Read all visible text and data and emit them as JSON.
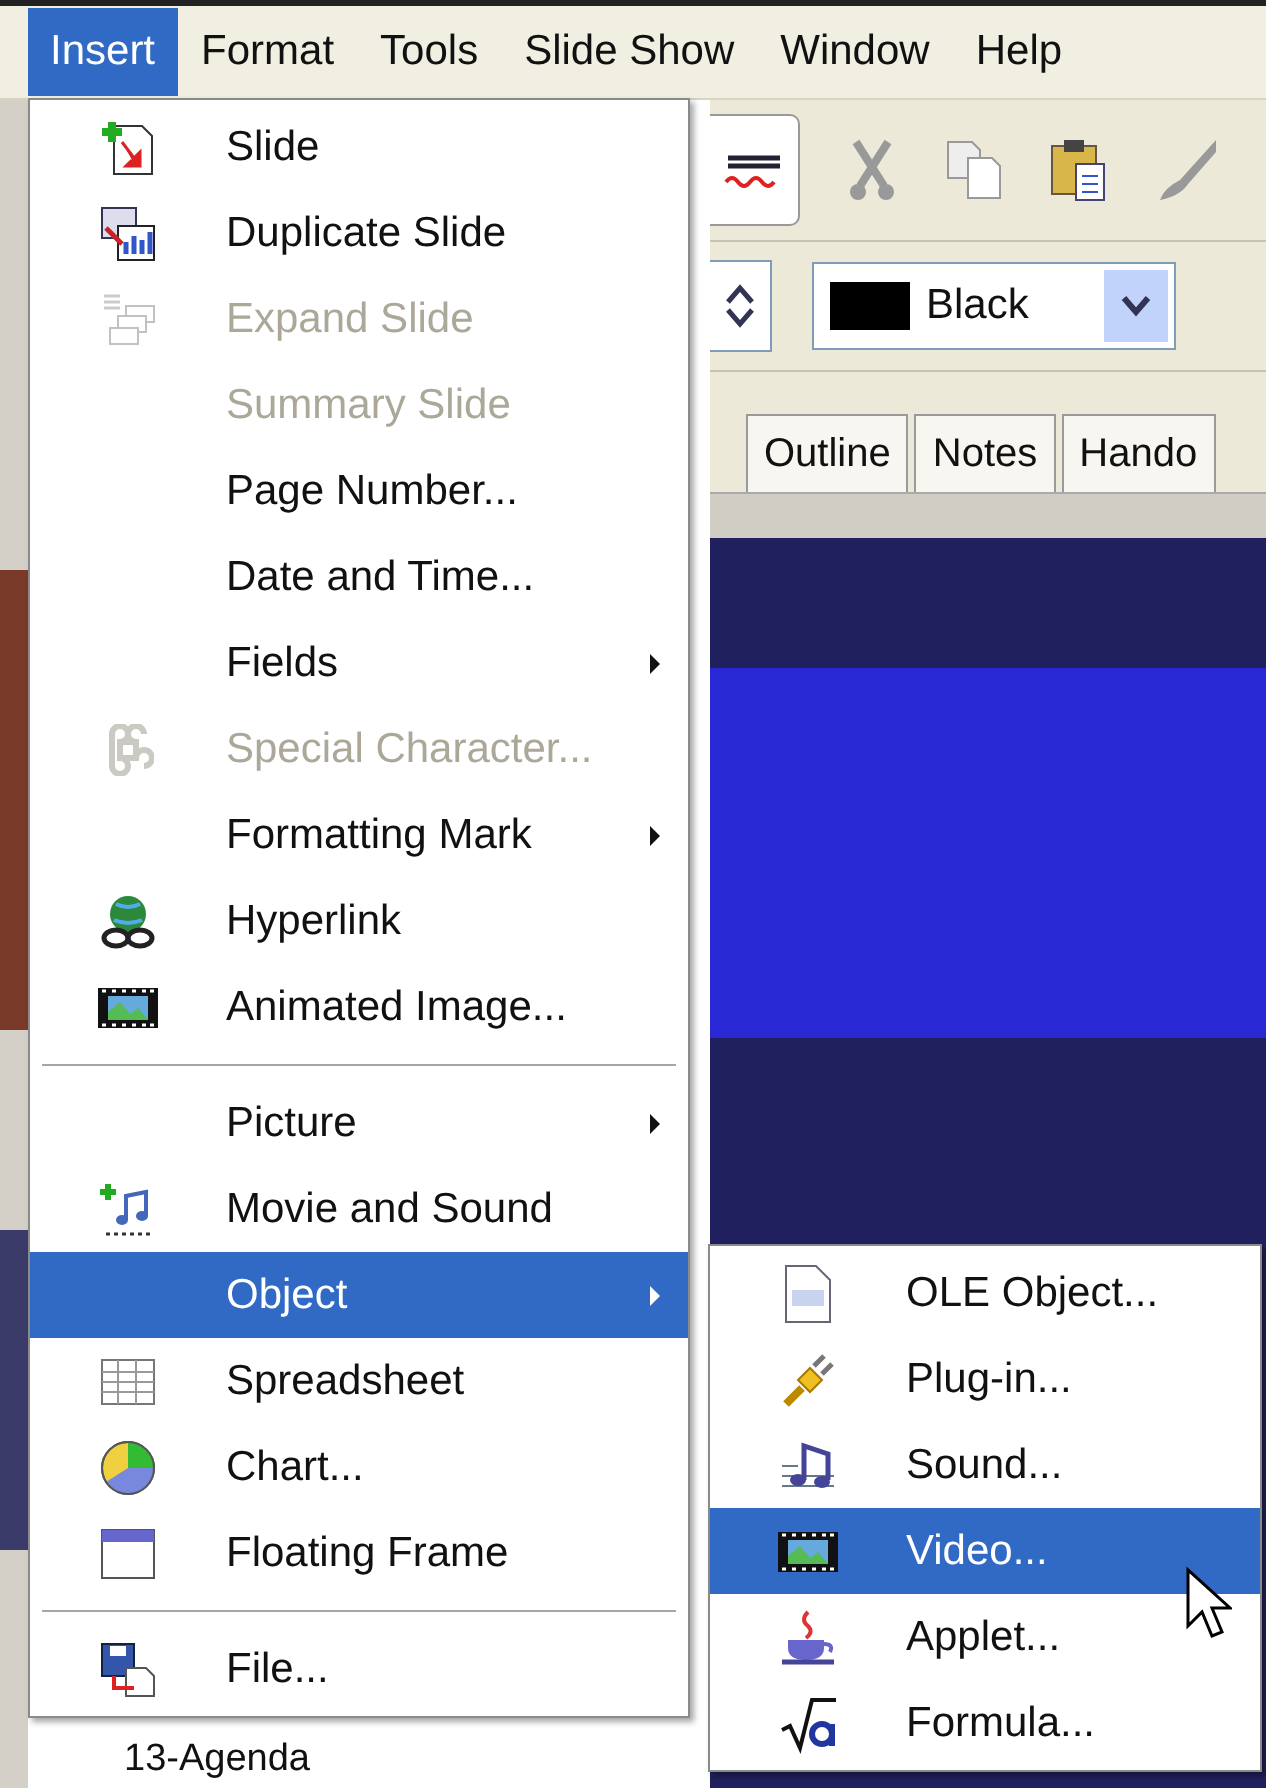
{
  "menubar": [
    {
      "label": "Insert",
      "selected": true
    },
    {
      "label": "Format",
      "selected": false
    },
    {
      "label": "Tools",
      "selected": false
    },
    {
      "label": "Slide Show",
      "selected": false
    },
    {
      "label": "Window",
      "selected": false
    },
    {
      "label": "Help",
      "selected": false
    }
  ],
  "toolbar": {
    "color_box": {
      "value": "Black"
    }
  },
  "view_tabs": [
    {
      "label": "Outline",
      "selected": false
    },
    {
      "label": "Notes",
      "selected": false
    },
    {
      "label": "Hando",
      "selected": false
    }
  ],
  "slide_panel": {
    "thumbnail_label": "13-Agenda"
  },
  "insert_menu": {
    "items": [
      {
        "kind": "item",
        "label": "Slide",
        "disabled": false,
        "selected": false,
        "submenu": false
      },
      {
        "kind": "item",
        "label": "Duplicate Slide",
        "disabled": false,
        "selected": false,
        "submenu": false
      },
      {
        "kind": "item",
        "label": "Expand Slide",
        "disabled": true,
        "selected": false,
        "submenu": false
      },
      {
        "kind": "item",
        "label": "Summary Slide",
        "disabled": true,
        "selected": false,
        "submenu": false
      },
      {
        "kind": "item",
        "label": "Page Number...",
        "disabled": false,
        "selected": false,
        "submenu": false
      },
      {
        "kind": "item",
        "label": "Date and Time...",
        "disabled": false,
        "selected": false,
        "submenu": false
      },
      {
        "kind": "item",
        "label": "Fields",
        "disabled": false,
        "selected": false,
        "submenu": true
      },
      {
        "kind": "item",
        "label": "Special Character...",
        "disabled": true,
        "selected": false,
        "submenu": false
      },
      {
        "kind": "item",
        "label": "Formatting Mark",
        "disabled": false,
        "selected": false,
        "submenu": true
      },
      {
        "kind": "item",
        "label": "Hyperlink",
        "disabled": false,
        "selected": false,
        "submenu": false
      },
      {
        "kind": "item",
        "label": "Animated Image...",
        "disabled": false,
        "selected": false,
        "submenu": false
      },
      {
        "kind": "separator"
      },
      {
        "kind": "item",
        "label": "Picture",
        "disabled": false,
        "selected": false,
        "submenu": true
      },
      {
        "kind": "item",
        "label": "Movie and Sound",
        "disabled": false,
        "selected": false,
        "submenu": false
      },
      {
        "kind": "item",
        "label": "Object",
        "disabled": false,
        "selected": true,
        "submenu": true
      },
      {
        "kind": "item",
        "label": "Spreadsheet",
        "disabled": false,
        "selected": false,
        "submenu": false
      },
      {
        "kind": "item",
        "label": "Chart...",
        "disabled": false,
        "selected": false,
        "submenu": false
      },
      {
        "kind": "item",
        "label": "Floating Frame",
        "disabled": false,
        "selected": false,
        "submenu": false
      },
      {
        "kind": "separator"
      },
      {
        "kind": "item",
        "label": "File...",
        "disabled": false,
        "selected": false,
        "submenu": false
      }
    ]
  },
  "object_submenu": {
    "items": [
      {
        "kind": "item",
        "label": "OLE Object...",
        "disabled": false,
        "selected": false,
        "submenu": false
      },
      {
        "kind": "item",
        "label": "Plug-in...",
        "disabled": false,
        "selected": false,
        "submenu": false
      },
      {
        "kind": "item",
        "label": "Sound...",
        "disabled": false,
        "selected": false,
        "submenu": false
      },
      {
        "kind": "item",
        "label": "Video...",
        "disabled": false,
        "selected": true,
        "submenu": false
      },
      {
        "kind": "item",
        "label": "Applet...",
        "disabled": false,
        "selected": false,
        "submenu": false
      },
      {
        "kind": "item",
        "label": "Formula...",
        "disabled": false,
        "selected": false,
        "submenu": false
      }
    ]
  }
}
